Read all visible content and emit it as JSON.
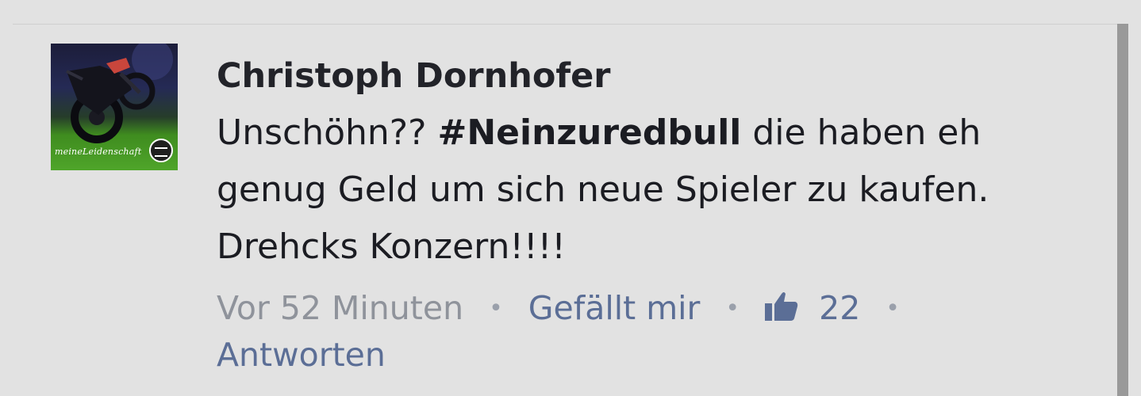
{
  "comment": {
    "author": "Christoph Dornhofer",
    "text_before": "Unschöhn?? ",
    "hashtag": "#Neinzuredbull",
    "text_after": " die haben eh genug Geld um sich neue Spieler zu kaufen. Drehcks Konzern!!!!",
    "avatar": {
      "caption": "meineLeidenschaft",
      "icon": "motorcycle-photo"
    }
  },
  "meta": {
    "timestamp": "Vor 52 Minuten",
    "separator": "•",
    "like_label": "Gefällt mir",
    "like_icon": "thumbs-up-icon",
    "like_count": "22",
    "reply_label": "Antworten"
  },
  "colors": {
    "background": "#e2e2e2",
    "author": "#222329",
    "link": "#5b6e96",
    "timestamp": "#8f939b"
  }
}
